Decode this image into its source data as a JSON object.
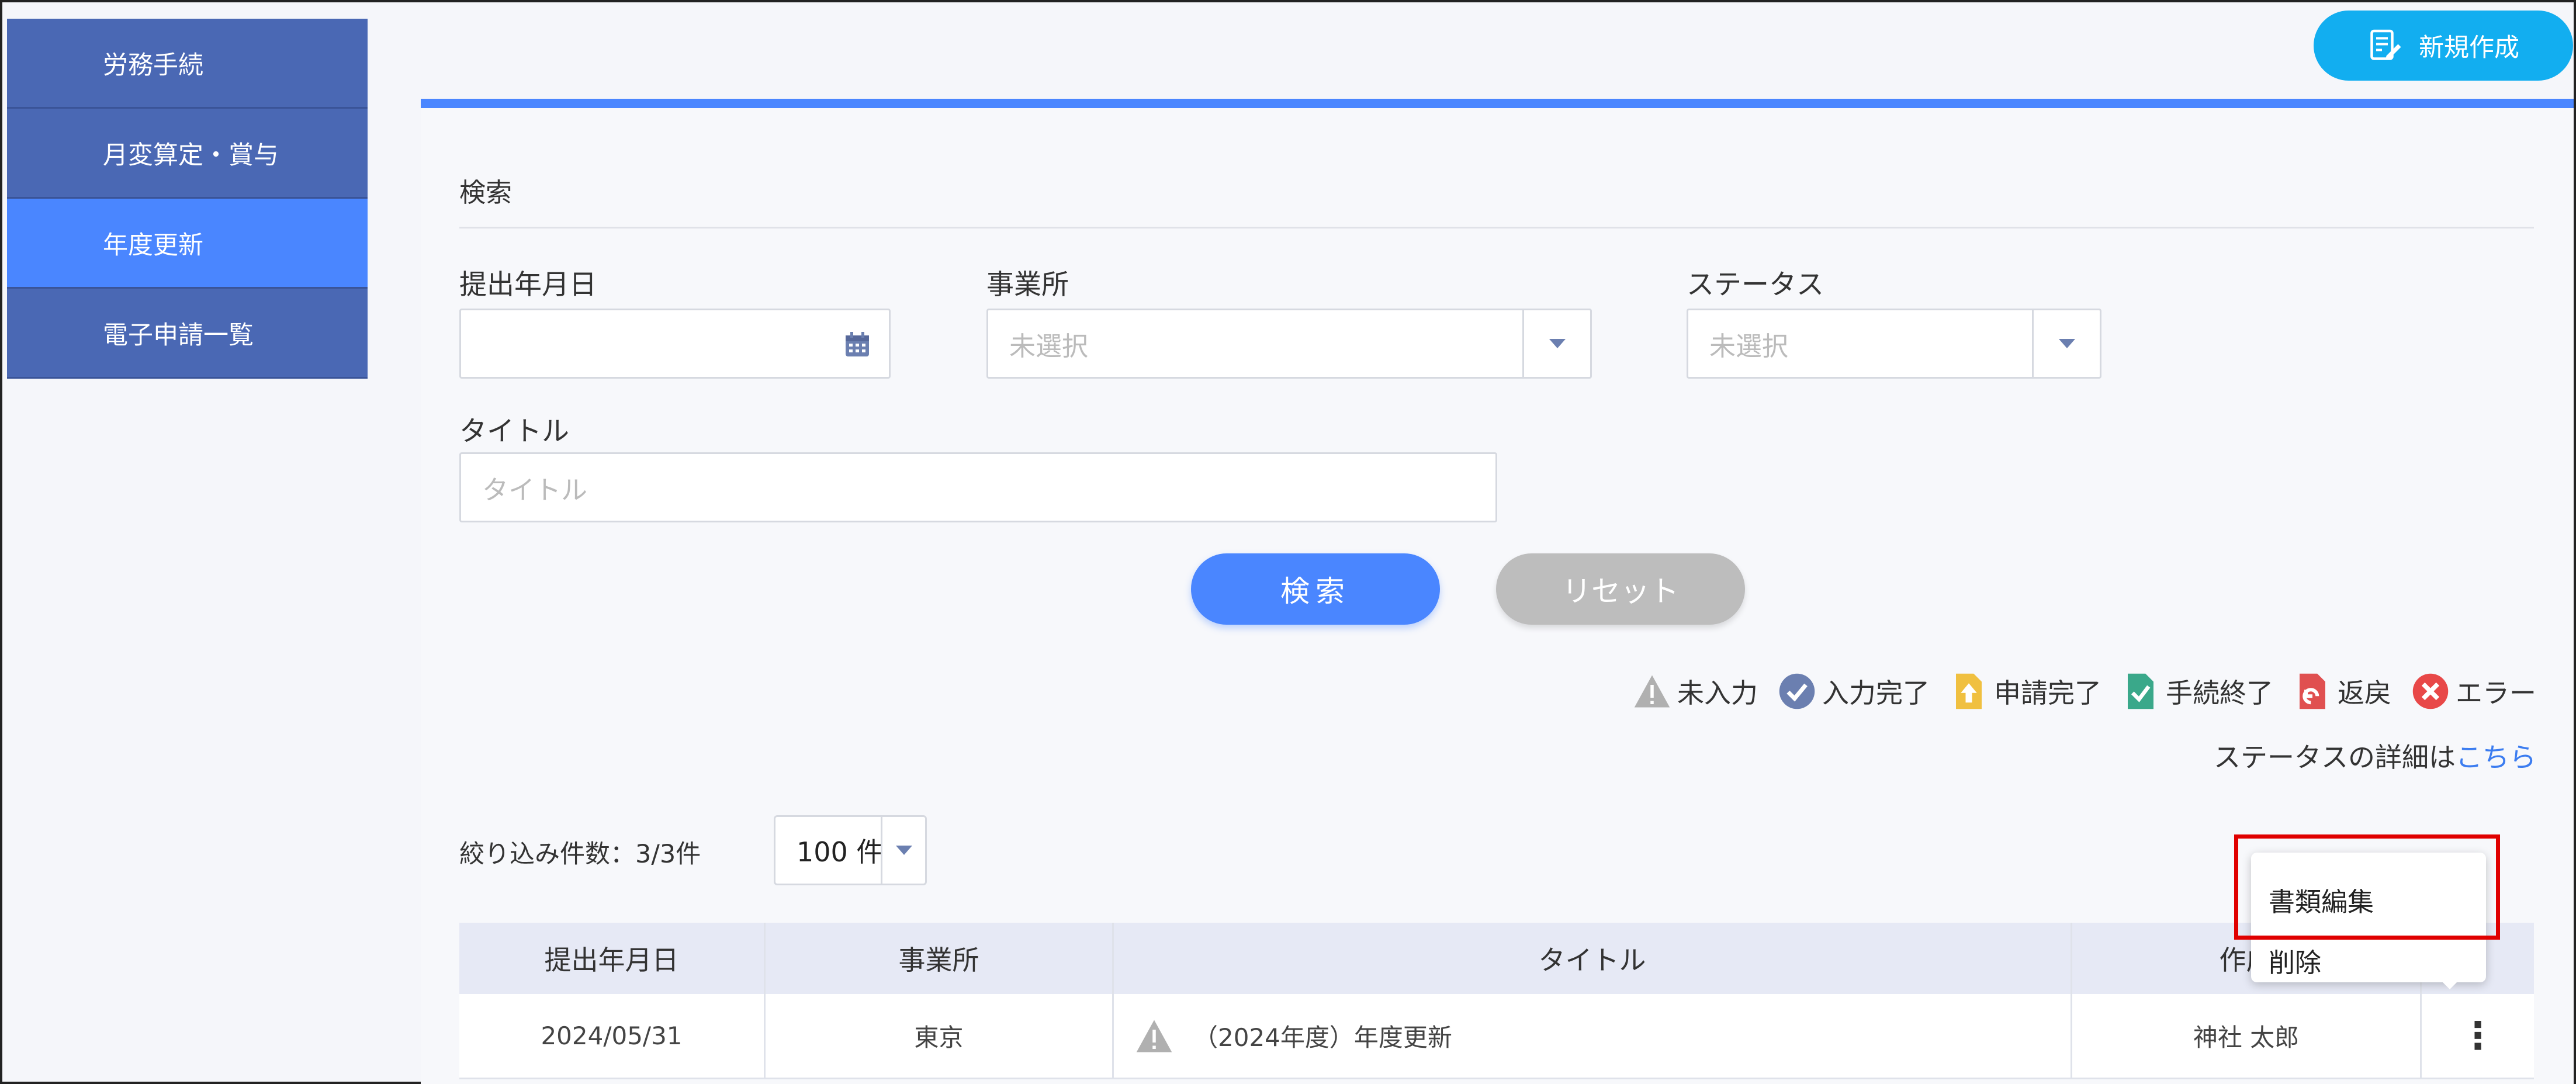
{
  "sidebar": {
    "items": [
      {
        "label": "労務手続"
      },
      {
        "label": "月変算定・賞与"
      },
      {
        "label": "年度更新"
      },
      {
        "label": "電子申請一覧"
      }
    ]
  },
  "header": {
    "new_button_label": "新規作成"
  },
  "search": {
    "section_title": "検索",
    "date_label": "提出年月日",
    "date_value": "",
    "office_label": "事業所",
    "office_value": "未選択",
    "status_label": "ステータス",
    "status_value": "未選択",
    "title_label": "タイトル",
    "title_placeholder": "タイトル",
    "search_button": "検索",
    "reset_button": "リセット"
  },
  "legend": {
    "items": [
      {
        "label": "未入力",
        "icon": "warning-icon",
        "color": "#b0b0b0"
      },
      {
        "label": "入力完了",
        "icon": "check-circle-icon",
        "color": "#6b7fb0"
      },
      {
        "label": "申請完了",
        "icon": "upload-doc-icon",
        "color": "#f0c040"
      },
      {
        "label": "手続終了",
        "icon": "doc-check-icon",
        "color": "#3aa88a"
      },
      {
        "label": "返戻",
        "icon": "return-doc-icon",
        "color": "#e05050"
      },
      {
        "label": "エラー",
        "icon": "error-circle-icon",
        "color": "#e84848"
      }
    ],
    "detail_text": "ステータスの詳細は",
    "detail_link": "こちら"
  },
  "list": {
    "count_text": "絞り込み件数：3/3件",
    "per_page": "100 件",
    "columns": [
      "提出年月日",
      "事業所",
      "タイトル",
      "作成"
    ],
    "rows": [
      {
        "date": "2024/05/31",
        "office": "東京",
        "title": "（2024年度）年度更新",
        "creator": "神社 太郎",
        "status_icon": "warning-icon"
      }
    ]
  },
  "context_menu": {
    "items": [
      {
        "label": "書類編集"
      },
      {
        "label": "削除"
      }
    ]
  },
  "colors": {
    "accent": "#4a86ff",
    "sidebar": "#4a68b4",
    "new_button": "#12aef0",
    "highlight": "#e00000"
  }
}
